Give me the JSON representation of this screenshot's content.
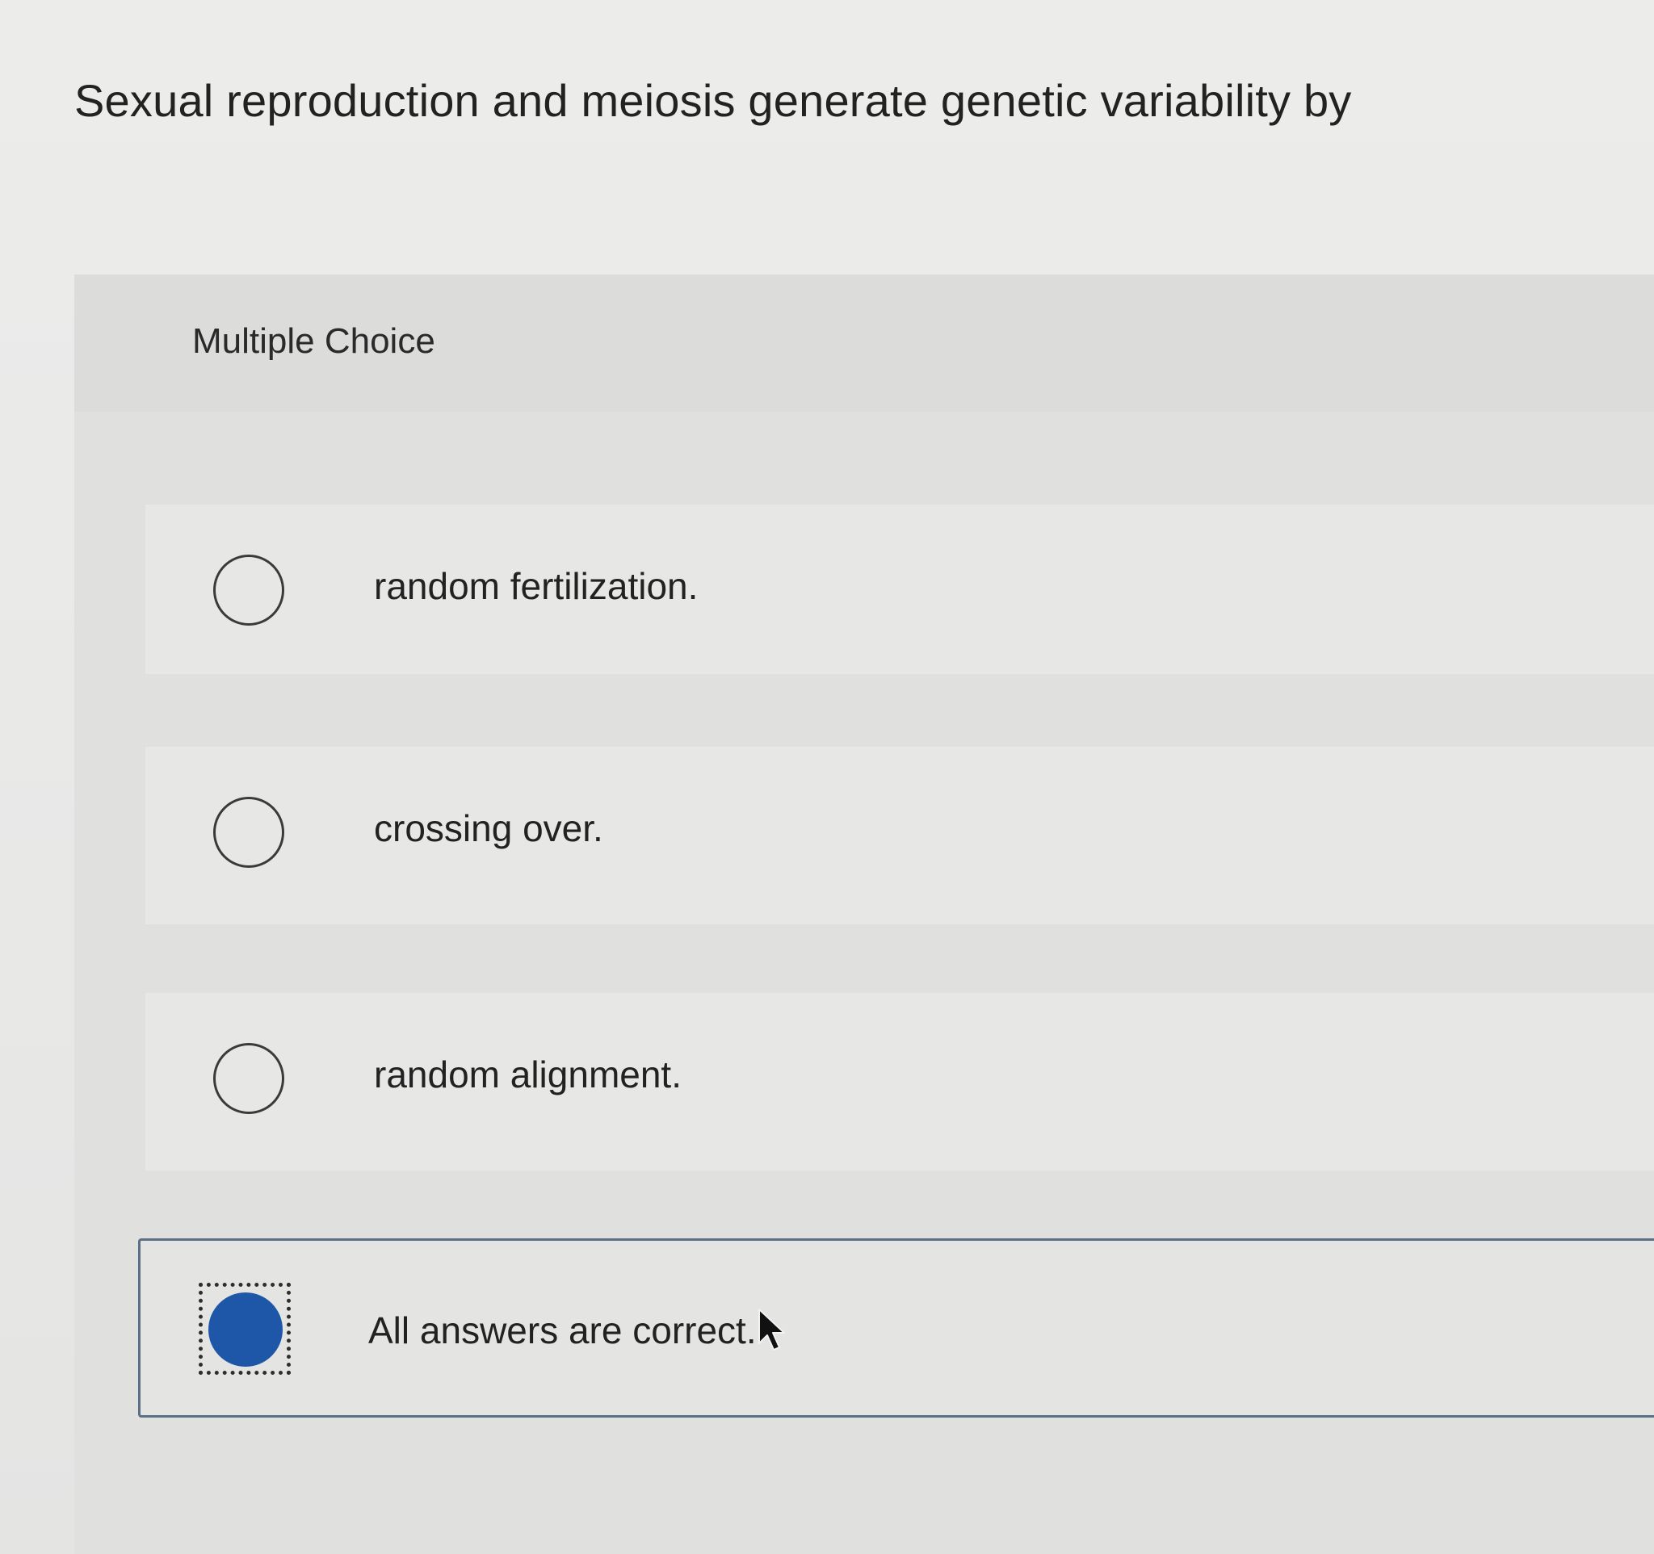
{
  "question": {
    "text": "Sexual reproduction and meiosis generate genetic variability by"
  },
  "panel": {
    "label": "Multiple Choice"
  },
  "options": [
    {
      "label": "random fertilization.",
      "selected": false
    },
    {
      "label": "crossing over.",
      "selected": false
    },
    {
      "label": "random alignment.",
      "selected": false
    },
    {
      "label": "All answers are correct.",
      "selected": true
    }
  ],
  "colors": {
    "selected_fill": "#1e57a8",
    "selected_border": "#5b6f86"
  },
  "icons": {
    "radio_unselected": "radio-empty-icon",
    "radio_selected": "radio-filled-icon",
    "cursor": "mouse-pointer-icon"
  }
}
